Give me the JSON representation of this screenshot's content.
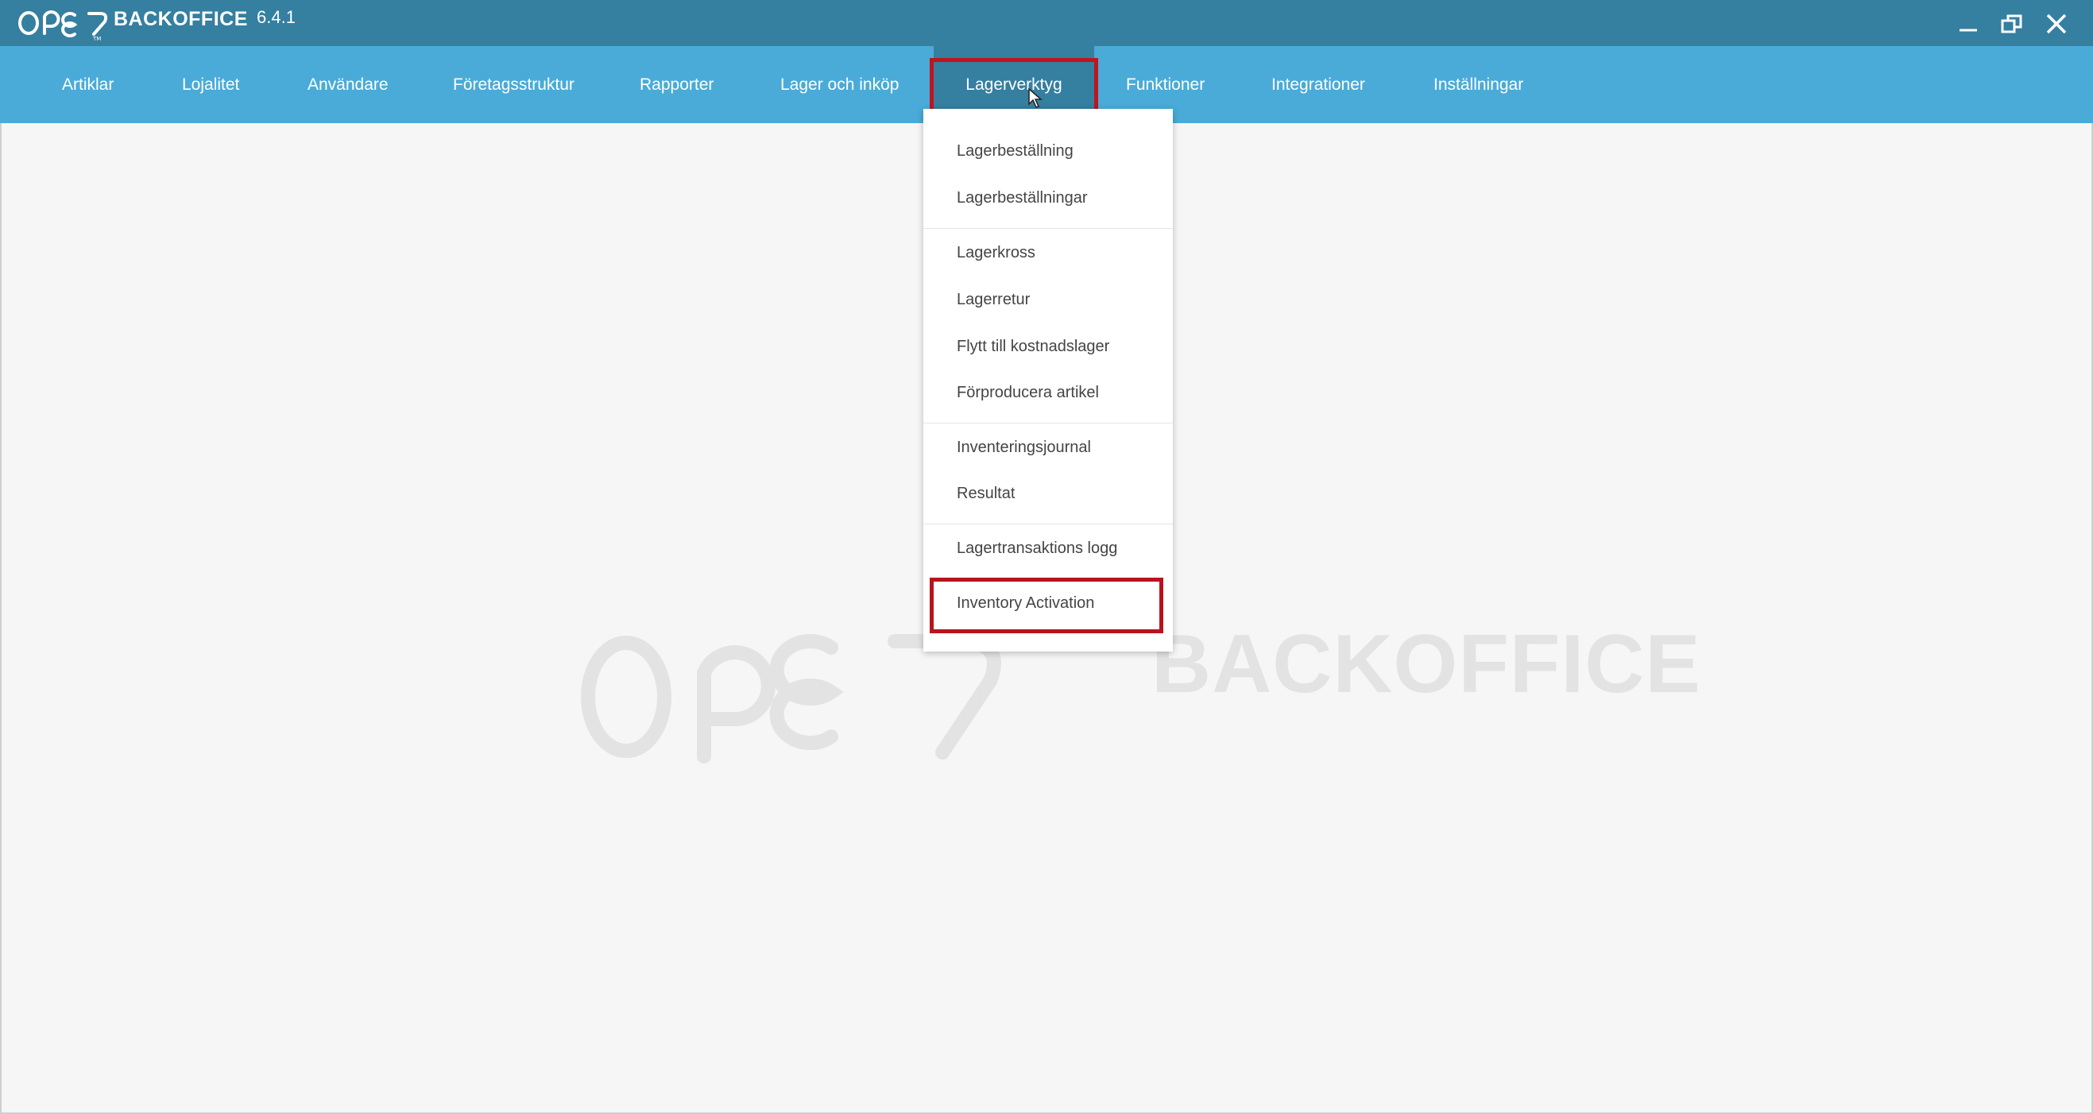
{
  "titlebar": {
    "brand": "BACKOFFICE",
    "version": "6.4.1",
    "controls": [
      "minimize-icon",
      "restore-icon",
      "close-icon"
    ]
  },
  "menu": {
    "items": [
      {
        "label": "Artiklar"
      },
      {
        "label": "Lojalitet"
      },
      {
        "label": "Användare"
      },
      {
        "label": "Företagsstruktur"
      },
      {
        "label": "Rapporter"
      },
      {
        "label": "Lager och inköp"
      },
      {
        "label": "Lagerverktyg",
        "active": true
      },
      {
        "label": "Funktioner"
      },
      {
        "label": "Integrationer"
      },
      {
        "label": "Inställningar"
      }
    ]
  },
  "dropdown": {
    "items": [
      {
        "label": "Lagerbeställning"
      },
      {
        "label": "Lagerbeställningar"
      },
      {
        "label": "Lagerkross"
      },
      {
        "label": "Lagerretur"
      },
      {
        "label": "Flytt till kostnadslager"
      },
      {
        "label": "Förproducera artikel"
      },
      {
        "label": "Inventeringsjournal"
      },
      {
        "label": "Resultat"
      },
      {
        "label": "Lagertransaktions logg"
      },
      {
        "label": "Inventory Activation",
        "highlighted": true
      }
    ]
  },
  "watermark": {
    "text": "BACKOFFICE"
  },
  "colors": {
    "titlebar": "#357fa0",
    "menubar": "#4aabd8",
    "highlight": "#c0141e",
    "background": "#f6f6f6"
  }
}
